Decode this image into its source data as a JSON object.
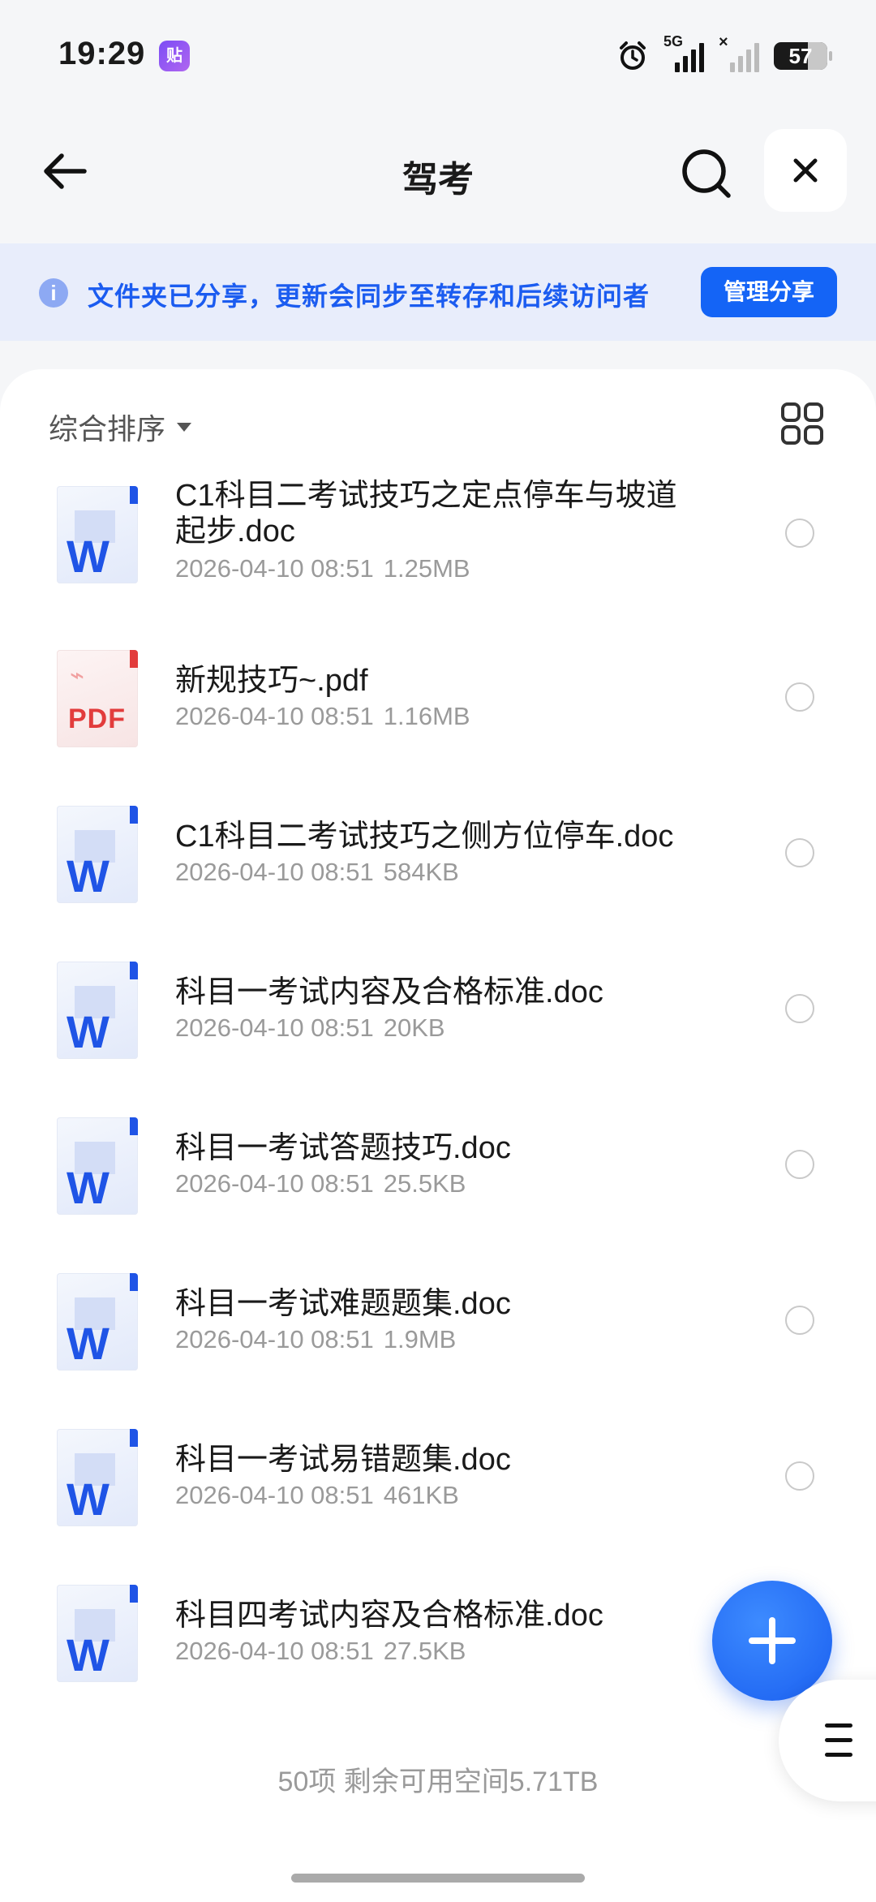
{
  "status_bar": {
    "time": "19:29",
    "app_badge": "贴",
    "network_label": "5G",
    "battery": "57"
  },
  "header": {
    "title": "驾考",
    "back_icon": "arrow-left-icon",
    "search_icon": "search-icon",
    "close_icon": "close-icon"
  },
  "banner": {
    "text": "文件夹已分享，更新会同步至转存和后续访问者",
    "button": "管理分享",
    "accent": "#1464f6"
  },
  "toolbar": {
    "sort_label": "综合排序",
    "view_icon": "grid-view-icon"
  },
  "files": [
    {
      "name": "C1科目二考试技巧之定点停车与坡道起步.doc",
      "date": "2026-04-10 08:51",
      "size": "1.25MB",
      "type": "doc"
    },
    {
      "name": "新规技巧~.pdf",
      "date": "2026-04-10 08:51",
      "size": "1.16MB",
      "type": "pdf"
    },
    {
      "name": "C1科目二考试技巧之侧方位停车.doc",
      "date": "2026-04-10 08:51",
      "size": "584KB",
      "type": "doc"
    },
    {
      "name": "科目一考试内容及合格标准.doc",
      "date": "2026-04-10 08:51",
      "size": "20KB",
      "type": "doc"
    },
    {
      "name": "科目一考试答题技巧.doc",
      "date": "2026-04-10 08:51",
      "size": "25.5KB",
      "type": "doc"
    },
    {
      "name": "科目一考试难题题集.doc",
      "date": "2026-04-10 08:51",
      "size": "1.9MB",
      "type": "doc"
    },
    {
      "name": "科目一考试易错题集.doc",
      "date": "2026-04-10 08:51",
      "size": "461KB",
      "type": "doc"
    },
    {
      "name": "科目四考试内容及合格标准.doc",
      "date": "2026-04-10 08:51",
      "size": "27.5KB",
      "type": "doc"
    }
  ],
  "footer": {
    "summary": "50项 剩余可用空间5.71TB"
  },
  "icons": {
    "doc_glyph": "W",
    "pdf_glyph": "PDF",
    "add": "plus-icon",
    "menu": "menu-icon"
  }
}
